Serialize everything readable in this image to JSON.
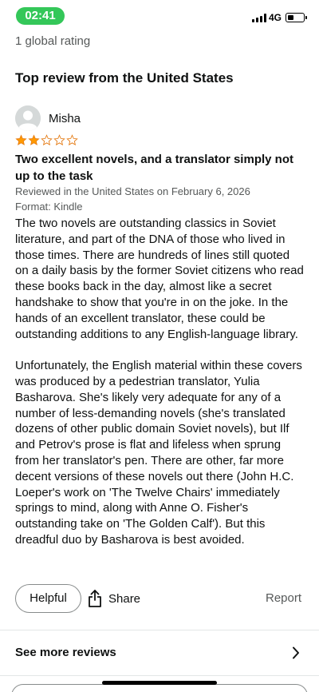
{
  "status_bar": {
    "time": "02:41",
    "network": "4G",
    "time_pill_color": "#34c759"
  },
  "rating_summary": {
    "global_rating": "1 global rating"
  },
  "section": {
    "title": "Top review from the United States"
  },
  "review": {
    "reviewer_name": "Misha",
    "rating": 2,
    "max_rating": 5,
    "star_color": "#ff9900",
    "title": "Two excellent novels, and a translator simply not up to the task",
    "reviewed_in": "Reviewed in the United States on February 6, 2026",
    "format": "Format: Kindle",
    "body": [
      "The two novels are outstanding classics in Soviet literature, and part of the DNA of those who lived in those times. There are hundreds of lines still quoted on a daily basis by the former Soviet citizens who read these books back in the day, almost like a secret handshake to show that you're in on the joke. In the hands of an excellent translator, these could be outstanding additions to any English-language library.",
      "Unfortunately, the English material within these covers was produced by a pedestrian translator, Yulia Basharova. She's likely very adequate for any of a number of less-demanding novels (she's translated dozens of other public domain Soviet novels), but Ilf and Petrov's prose is flat and lifeless when sprung from her translator's pen. There are other, far more decent versions of these novels out there (John H.C. Loeper's work on 'The Twelve Chairs' immediately springs to mind, along with Anne O. Fisher's outstanding take on 'The Golden Calf'). But this dreadful duo by Basharova is best avoided."
    ]
  },
  "actions": {
    "helpful_label": "Helpful",
    "share_label": "Share",
    "report_label": "Report"
  },
  "footer": {
    "see_more_label": "See more reviews"
  },
  "icons": {
    "share": "share-icon",
    "chevron": "chevron-right-icon",
    "avatar": "user-avatar-icon"
  }
}
